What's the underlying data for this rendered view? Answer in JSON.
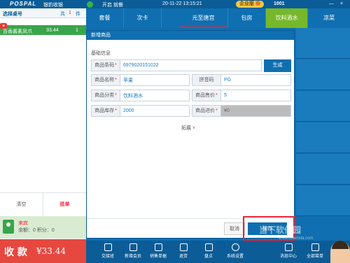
{
  "topbar": {
    "brand": "POSPAL",
    "brand_sub": "银豹收银",
    "status_open": "开启",
    "status_mode": "就餐",
    "datetime": "20-11-22 13:15:21",
    "enterprise_badge": "企业版",
    "user_id": "1001",
    "min_symbol": "—",
    "close_symbol": "×"
  },
  "left_panel": {
    "header": {
      "title": "选择桌号",
      "qty_col": "共",
      "qty_value": "1",
      "unit_col": "件"
    },
    "order_items": [
      {
        "name": "百香酱素凤爪",
        "price": "33.44",
        "qty": "1"
      }
    ],
    "clear_button": "清空",
    "hold_button": "挂单",
    "member": {
      "name": "来宾",
      "balance_points": "余额：0  积分：0"
    },
    "pay": {
      "label": "收 款",
      "amount": "¥33.44"
    }
  },
  "tabs": [
    {
      "label": "套餐",
      "active": false
    },
    {
      "label": "次卡",
      "active": false
    },
    {
      "label": "元至唐宫",
      "active": false
    },
    {
      "label": "包房",
      "active": false
    },
    {
      "label": "饮料酒水",
      "active": true
    },
    {
      "label": "凉菜",
      "active": false
    }
  ],
  "dialog": {
    "title": "新增商品",
    "section": "基础信息",
    "fields": {
      "barcode": {
        "label": "商品条码",
        "value": "6979020151022"
      },
      "name": {
        "label": "商品名称",
        "value": "苹果"
      },
      "pinyin": {
        "label": "拼音码",
        "value": "PG"
      },
      "category": {
        "label": "商品分类",
        "value": "饮料酒水"
      },
      "sale_price": {
        "label": "商品售价",
        "value": "5"
      },
      "stock": {
        "label": "商品库存",
        "value": "2000"
      },
      "purchase_price": {
        "label": "商品进价",
        "value": "¥0"
      }
    },
    "generate_button": "生成",
    "expand_label": "拓展",
    "cancel_button": "取消",
    "save_button": "保存"
  },
  "toolbar": [
    {
      "label": "交接班",
      "icon": "handover-icon"
    },
    {
      "label": "新增会员",
      "icon": "add-member-icon"
    },
    {
      "label": "销售单据",
      "icon": "receipt-icon"
    },
    {
      "label": "退货",
      "icon": "return-icon"
    },
    {
      "label": "盘点",
      "icon": "inventory-icon"
    },
    {
      "label": "系统设置",
      "icon": "settings-icon"
    },
    {
      "label": "消息中心",
      "icon": "message-icon"
    },
    {
      "label": "全部菜单",
      "icon": "menu-icon"
    }
  ],
  "watermark": {
    "text": "当下软件园",
    "sub": "www.downxia.com"
  },
  "colors": {
    "primary": "#0f6fb0",
    "accent_green": "#76b82a",
    "danger": "#e6483f"
  }
}
